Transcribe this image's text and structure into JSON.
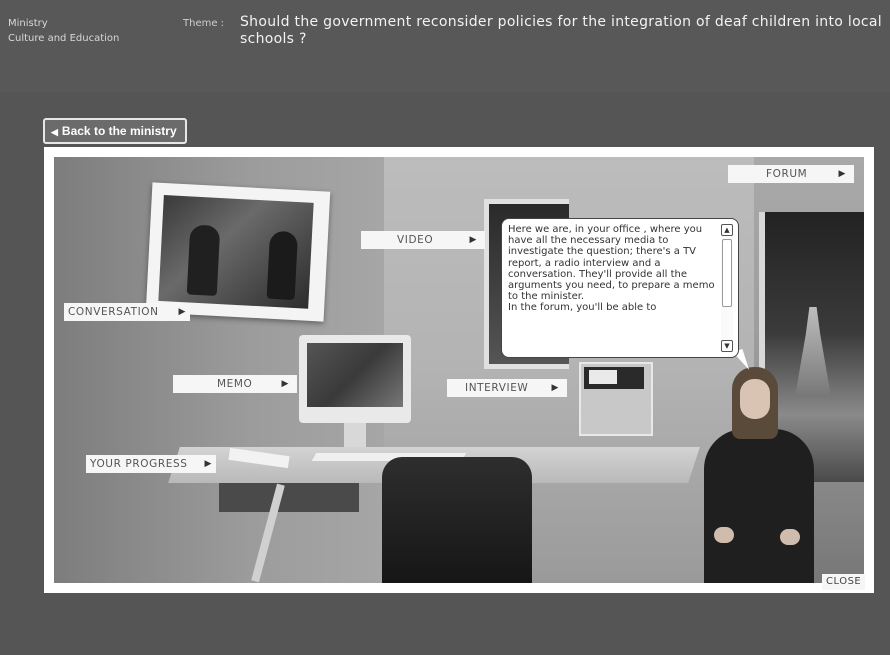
{
  "header": {
    "ministry_label": "Ministry",
    "ministry_name": "Culture and Education",
    "theme_label": "Theme :",
    "theme_text": "Should the government reconsider policies for the integration of deaf children into local schools ?"
  },
  "back_button": {
    "label": "Back to the ministry",
    "icon": "triangle-left-icon"
  },
  "nav": {
    "forum": "FORUM",
    "video": "VIDEO",
    "conversation": "CONVERSATION",
    "memo": "MEMO",
    "interview": "INTERVIEW",
    "your_progress": "YOUR PROGRESS"
  },
  "speech_bubble": {
    "text": "Here we are, in your office , where you have all the necessary media to investigate the question;  there's a TV report, a radio interview and a conversation. They'll provide all the arguments you need, to prepare a memo to the minister.\nIn the forum, you'll be able to"
  },
  "close_button": {
    "label": "CLOSE"
  },
  "colors": {
    "background": "#555555",
    "panel": "#ffffff",
    "label_bg": "#f6f6f6"
  }
}
